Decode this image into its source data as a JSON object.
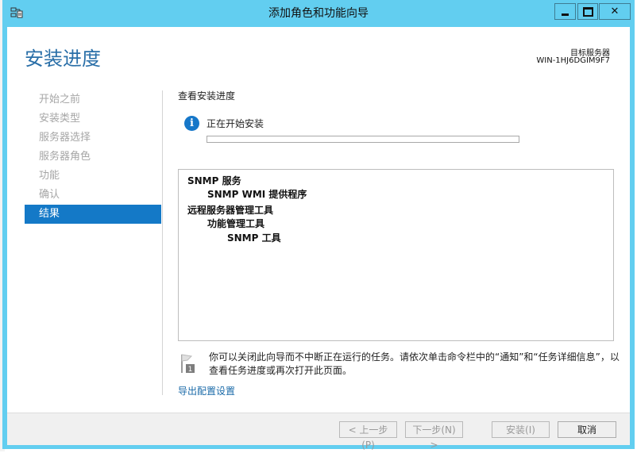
{
  "window": {
    "title": "添加角色和功能向导",
    "close_glyph": "✕"
  },
  "header": {
    "page_title": "安装进度",
    "target_server_label": "目标服务器",
    "target_server_name": "WIN-1HJ6DGIM9F7"
  },
  "nav": {
    "items": [
      {
        "label": "开始之前",
        "active": false
      },
      {
        "label": "安装类型",
        "active": false
      },
      {
        "label": "服务器选择",
        "active": false
      },
      {
        "label": "服务器角色",
        "active": false
      },
      {
        "label": "功能",
        "active": false
      },
      {
        "label": "确认",
        "active": false
      },
      {
        "label": "结果",
        "active": true
      }
    ]
  },
  "content": {
    "section_label": "查看安装进度",
    "status_text": "正在开始安装",
    "info_glyph": "i",
    "progress": 0,
    "results": [
      {
        "text": "SNMP 服务",
        "level": 0
      },
      {
        "text": "SNMP WMI 提供程序",
        "level": 1
      },
      {
        "text": "远程服务器管理工具",
        "level": 0
      },
      {
        "text": "功能管理工具",
        "level": 1
      },
      {
        "text": "SNMP 工具",
        "level": 2
      }
    ],
    "note_flag_number": "1",
    "note_text": "你可以关闭此向导而不中断正在运行的任务。请依次单击命令栏中的“通知”和“任务详细信息”，以查看任务进度或再次打开此页面。",
    "export_link": "导出配置设置"
  },
  "footer": {
    "prev_label": "< 上一步(P)",
    "next_label": "下一步(N) >",
    "install_label": "安装(I)",
    "cancel_label": "取消"
  },
  "colors": {
    "title_bar": "#62cef0",
    "accent": "#1479c7",
    "page_title": "#2a6fa8",
    "link": "#1a6aa8"
  }
}
